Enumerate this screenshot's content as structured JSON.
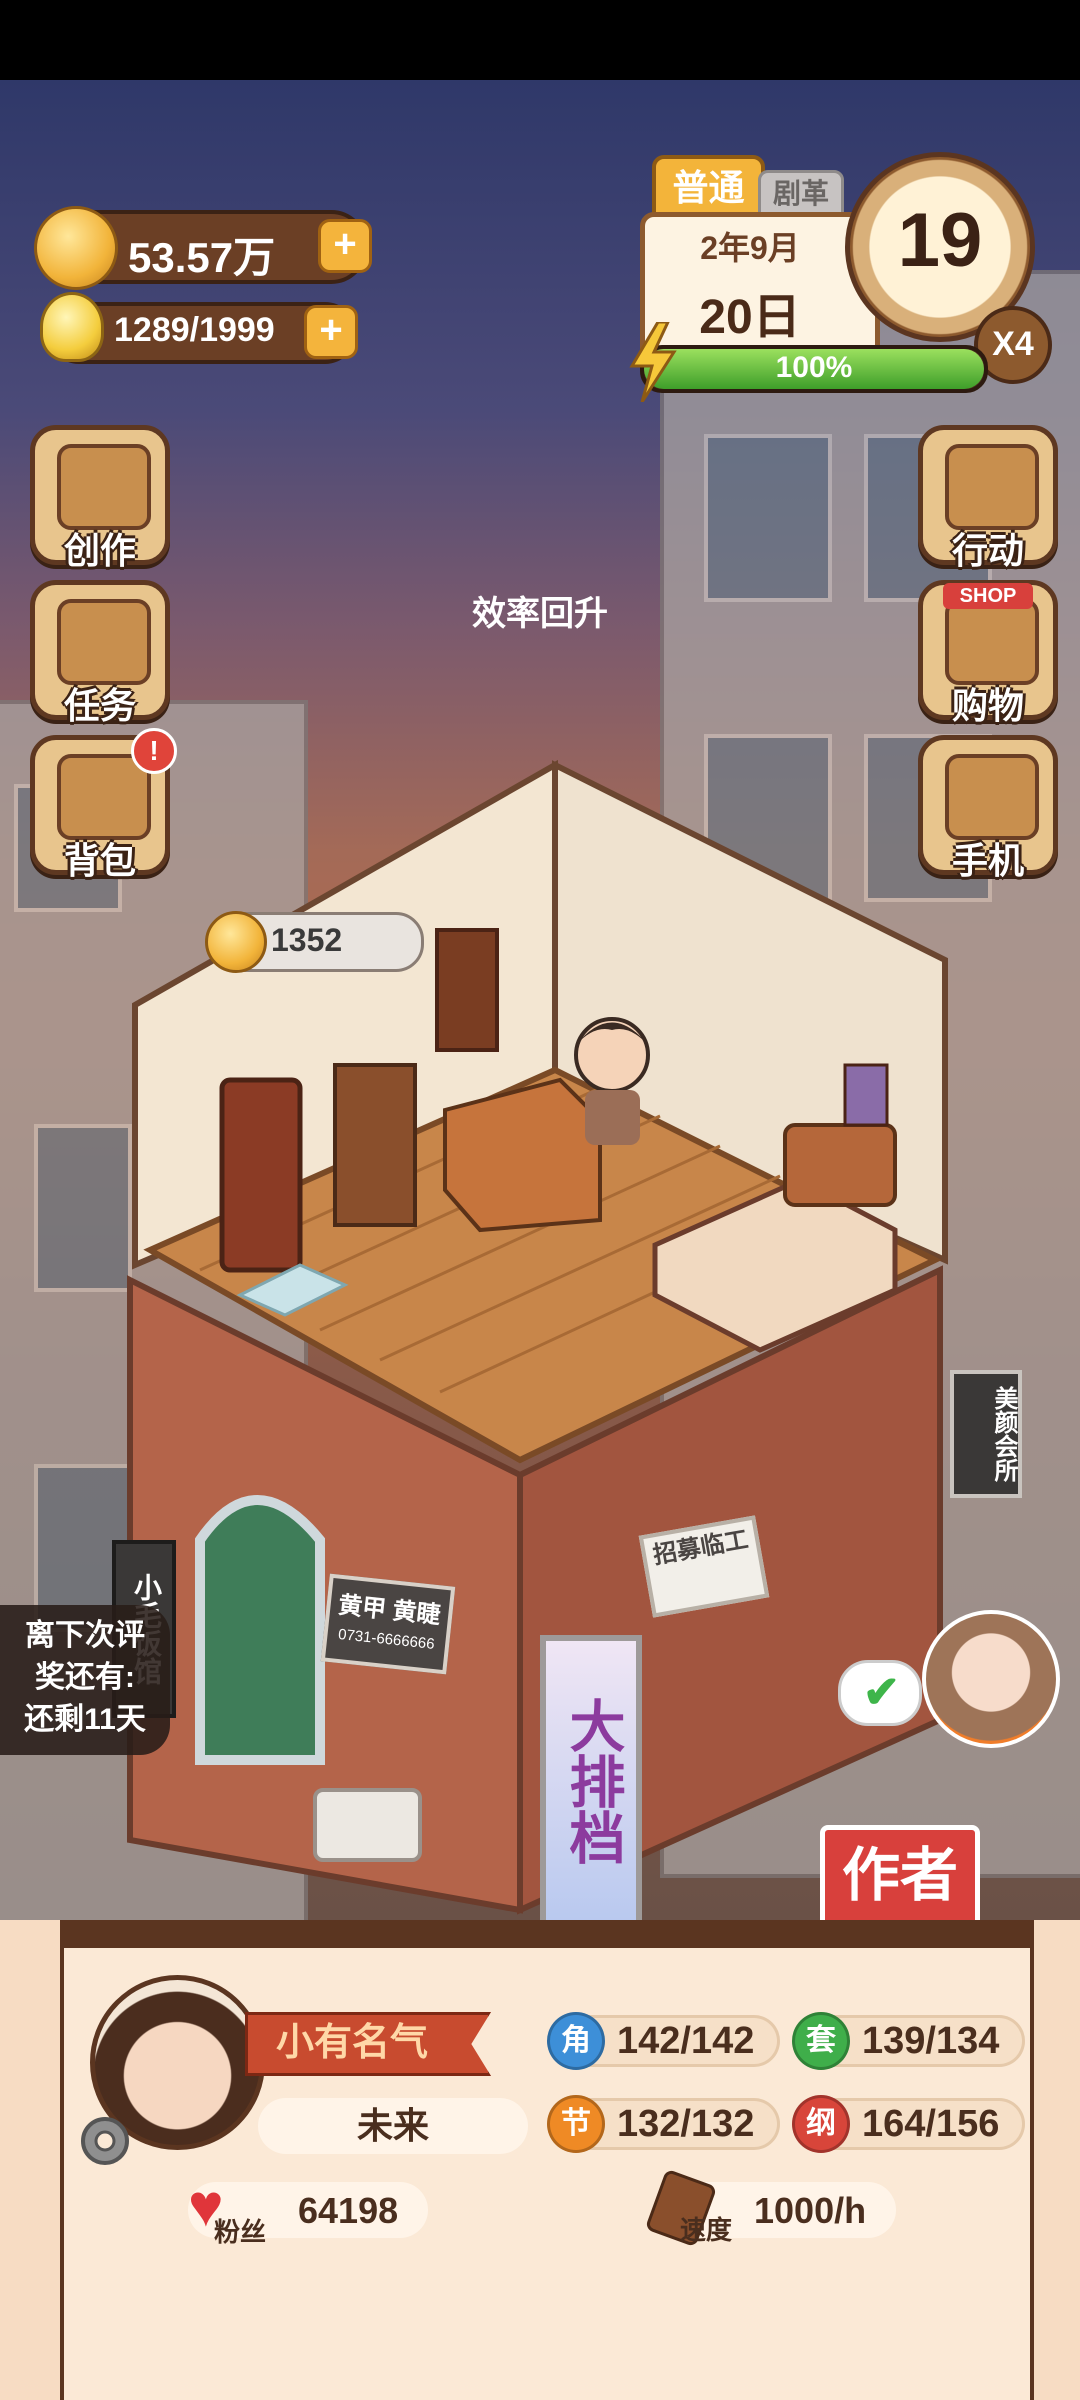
{
  "hud": {
    "coins_value": "53.57万",
    "energy_value": "1289/1999",
    "difficulty_tab": "普通",
    "hidden_tab": "剧革",
    "date_line": "2年9月",
    "day_line": "20日",
    "clock_value": "19",
    "speed_multiplier": "X4",
    "progress_percent": 100,
    "progress_label": "100%"
  },
  "left_menu": [
    {
      "label": "创作",
      "icon": "book-icon"
    },
    {
      "label": "任务",
      "icon": "clipboard-icon"
    },
    {
      "label": "背包",
      "icon": "bag-icon",
      "alert": "!"
    }
  ],
  "right_menu": [
    {
      "label": "行动",
      "icon": "door-icon"
    },
    {
      "label": "购物",
      "icon": "shop-icon",
      "sign": "SHOP"
    },
    {
      "label": "手机",
      "icon": "phone-icon"
    }
  ],
  "scene": {
    "floating_message": "效率回升",
    "room_coin_value": "1352",
    "shop_sign_left": "小毛饭馆",
    "door_sign": "黄甲 黄睫",
    "door_phone": "0731-6666666",
    "recruit_sign": "招募临工",
    "banner_sign": "大排档",
    "right_hanging_sign": "美颜会所",
    "next_review_line1": "离下次评",
    "next_review_line2": "奖还有:",
    "next_review_line3": "还剩11天",
    "author_button": "作者"
  },
  "profile": {
    "title_badge": "小有名气",
    "name": "未来",
    "fans_label": "粉丝",
    "fans_value": "64198",
    "speed_label": "速度",
    "speed_value": "1000/h",
    "stats": [
      {
        "badge": "角",
        "value": "142/142",
        "color": "#3d8fd8"
      },
      {
        "badge": "套",
        "value": "139/134",
        "color": "#3fae4a"
      },
      {
        "badge": "节",
        "value": "132/132",
        "color": "#ef8a25"
      },
      {
        "badge": "纲",
        "value": "164/156",
        "color": "#d8453a"
      }
    ]
  }
}
